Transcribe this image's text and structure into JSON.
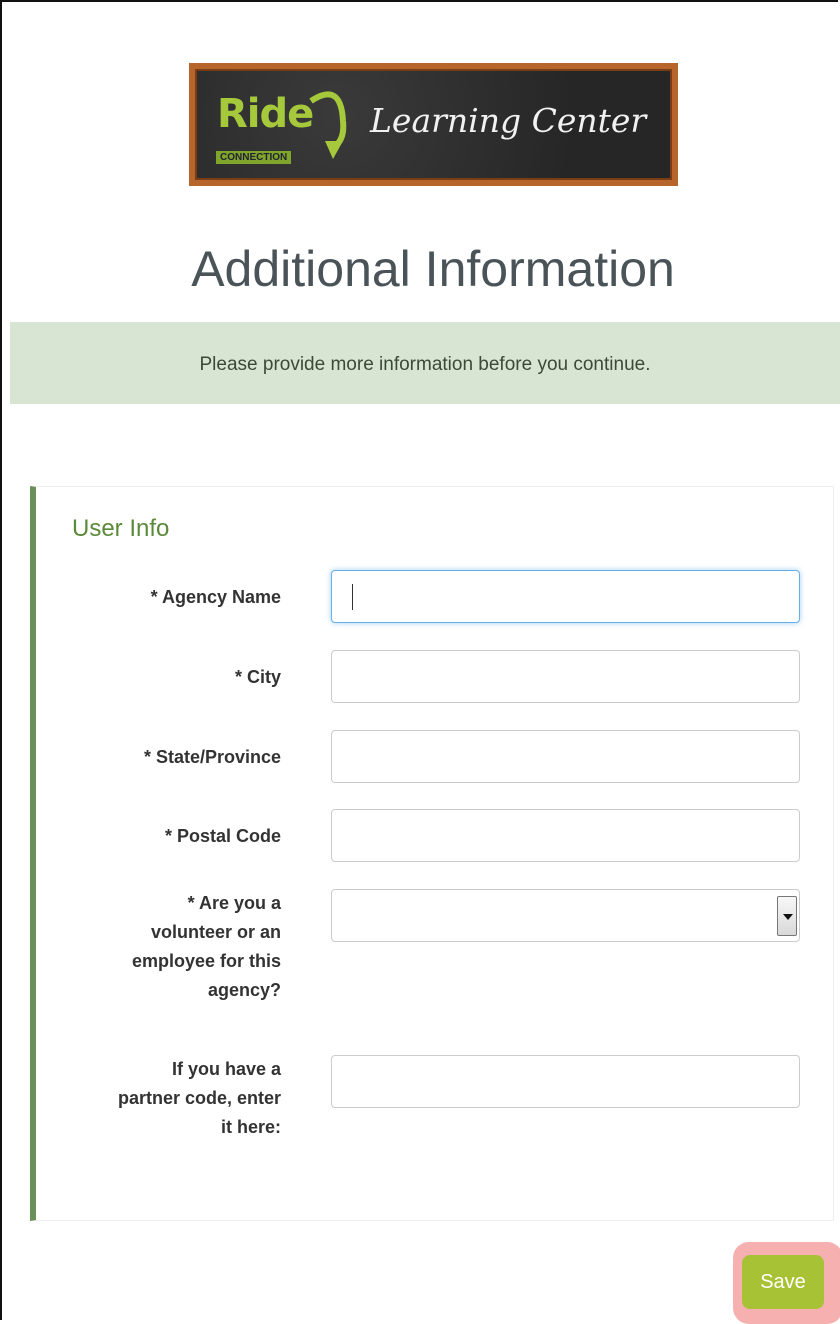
{
  "logo": {
    "brand": "Ride",
    "brand_sub": "CONNECTION",
    "tagline": "Learning Center"
  },
  "page": {
    "title": "Additional Information",
    "notice": "Please provide more information before you continue."
  },
  "form": {
    "section_title": "User Info",
    "fields": [
      {
        "label": "* Agency Name",
        "value": ""
      },
      {
        "label": "* City",
        "value": ""
      },
      {
        "label": "* State/Province",
        "value": ""
      },
      {
        "label": "* Postal Code",
        "value": ""
      },
      {
        "label_lines": [
          "* Are you a",
          "volunteer or an",
          "employee for this",
          "agency?"
        ],
        "selected": ""
      },
      {
        "label_lines": [
          "If you have a",
          "partner code, enter",
          "it here:"
        ],
        "value": ""
      }
    ]
  },
  "actions": {
    "save_label": "Save"
  },
  "colors": {
    "accent_green": "#a7c234",
    "panel_border": "#6b8f58",
    "notice_bg": "#d8e5d3"
  }
}
